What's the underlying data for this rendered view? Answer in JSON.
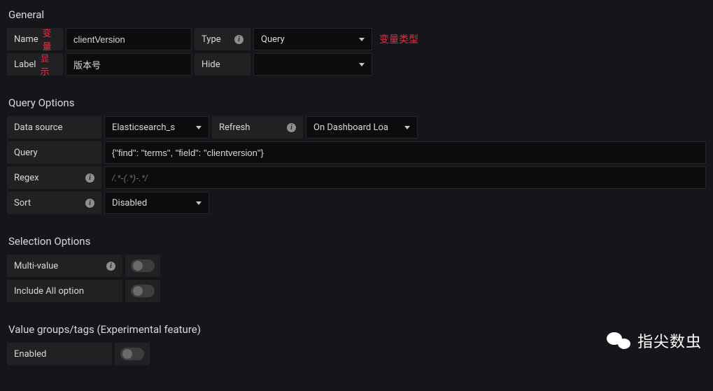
{
  "general": {
    "title": "General",
    "name_label": "Name",
    "name_annot": "变量",
    "name_value": "clientVersion",
    "type_label": "Type",
    "type_value": "Query",
    "type_annot": "变量类型",
    "label_label": "Label",
    "label_annot": "显示",
    "label_value": "版本号",
    "hide_label": "Hide",
    "hide_value": ""
  },
  "query_options": {
    "title": "Query Options",
    "datasource_label": "Data source",
    "datasource_value": "Elasticsearch_s",
    "refresh_label": "Refresh",
    "refresh_value": "On Dashboard Loa",
    "query_label": "Query",
    "query_value": "{\"find\": \"terms\", \"field\": \"clientversion\"}",
    "regex_label": "Regex",
    "regex_placeholder": "/.*-(.*)-.*/",
    "regex_value": "",
    "sort_label": "Sort",
    "sort_value": "Disabled"
  },
  "selection_options": {
    "title": "Selection Options",
    "multi_value_label": "Multi-value",
    "include_all_label": "Include All option"
  },
  "value_groups": {
    "title": "Value groups/tags (Experimental feature)",
    "enabled_label": "Enabled"
  },
  "watermark": "指尖数虫"
}
